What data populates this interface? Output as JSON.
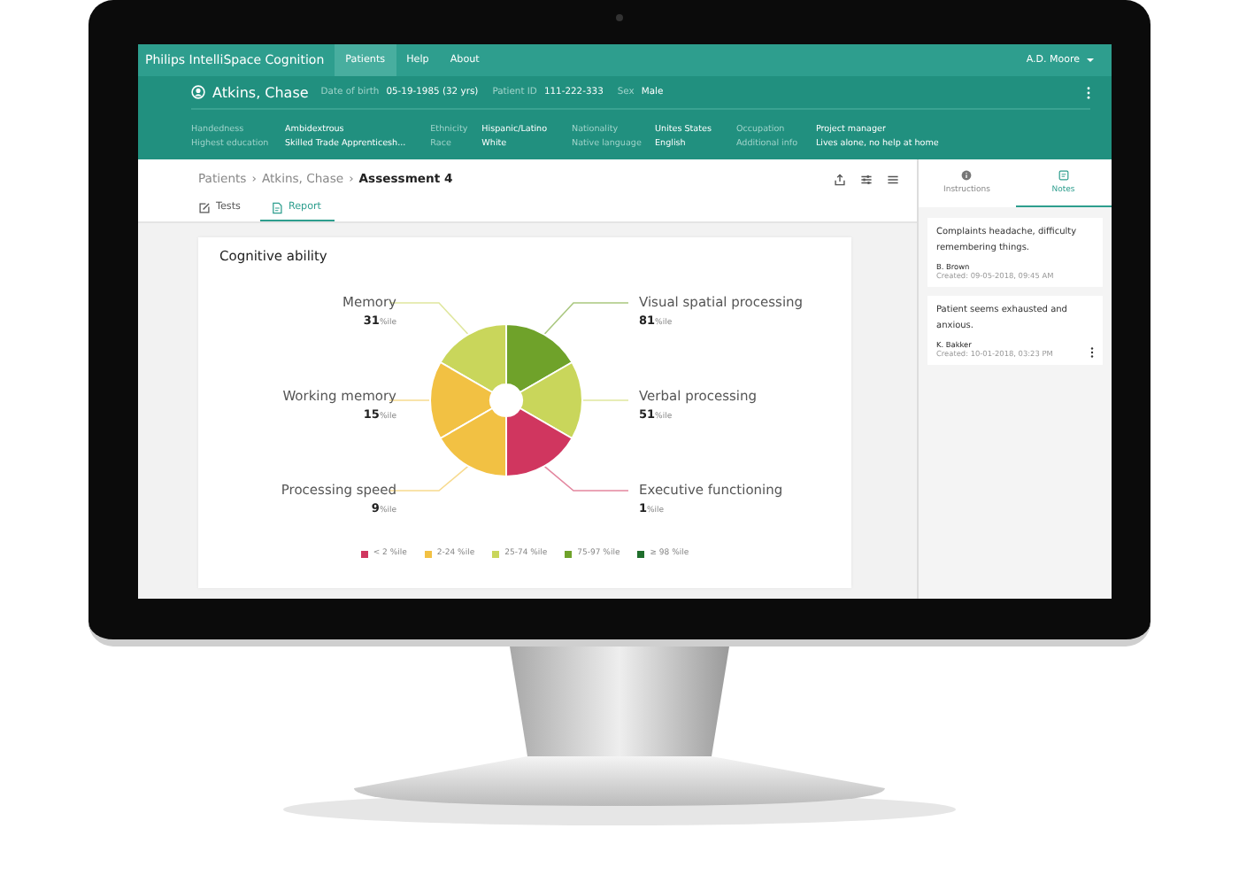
{
  "app": {
    "brand": "Philips IntelliSpace Cognition",
    "nav": [
      {
        "label": "Patients",
        "selected": true
      },
      {
        "label": "Help",
        "selected": false
      },
      {
        "label": "About",
        "selected": false
      }
    ],
    "user": "A.D. Moore"
  },
  "patient": {
    "name": "Atkins, Chase",
    "summary": [
      {
        "label": "Date of birth",
        "value": "05-19-1985 (32 yrs)"
      },
      {
        "label": "Patient ID",
        "value": "111-222-333"
      },
      {
        "label": "Sex",
        "value": "Male"
      }
    ],
    "details": [
      {
        "label": "Handedness",
        "value": "Ambidextrous"
      },
      {
        "label": "Highest education",
        "value": "Skilled Trade Apprenticesh..."
      },
      {
        "label": "Ethnicity",
        "value": "Hispanic/Latino"
      },
      {
        "label": "Race",
        "value": "White"
      },
      {
        "label": "Nationality",
        "value": "Unites States"
      },
      {
        "label": "Native language",
        "value": "English"
      },
      {
        "label": "Occupation",
        "value": "Project manager"
      },
      {
        "label": "Additional info",
        "value": "Lives alone, no help at home"
      }
    ]
  },
  "breadcrumb": {
    "items": [
      "Patients",
      "Atkins, Chase",
      "Assessment 4"
    ],
    "separator": "›"
  },
  "tabs": [
    {
      "label": "Tests",
      "kind": "tests",
      "selected": false
    },
    {
      "label": "Report",
      "kind": "report",
      "selected": true
    }
  ],
  "card": {
    "title": "Cognitive ability",
    "domains": [
      {
        "name": "Memory",
        "value": "31",
        "unit": "%ile",
        "color": "#c9d65b"
      },
      {
        "name": "Visual spatial processing",
        "value": "81",
        "unit": "%ile",
        "color": "#6fa22a"
      },
      {
        "name": "Working memory",
        "value": "15",
        "unit": "%ile",
        "color": "#f2c143"
      },
      {
        "name": "Verbal processing",
        "value": "51",
        "unit": "%ile",
        "color": "#c9d65b"
      },
      {
        "name": "Processing speed",
        "value": "9",
        "unit": "%ile",
        "color": "#f2c143"
      },
      {
        "name": "Executive functioning",
        "value": "1",
        "unit": "%ile",
        "color": "#d0365f"
      }
    ],
    "legend": [
      {
        "label": "< 2 %ile",
        "color": "#d0365f"
      },
      {
        "label": "2-24 %ile",
        "color": "#f2c143"
      },
      {
        "label": "25-74 %ile",
        "color": "#c9d65b"
      },
      {
        "label": "75-97 %ile",
        "color": "#6fa22a"
      },
      {
        "label": "≥ 98 %ile",
        "color": "#1f6e2c"
      }
    ]
  },
  "side_tabs": [
    {
      "label": "Instructions",
      "kind": "info",
      "selected": false
    },
    {
      "label": "Notes",
      "kind": "notes",
      "selected": true
    }
  ],
  "notes": [
    {
      "text": "Complaints headache, difficulty remembering things.",
      "author": "B. Brown",
      "created": "Created: 09-05-2018, 09:45 AM",
      "menu": false
    },
    {
      "text": "Patient seems exhausted and anxious.",
      "author": "K. Bakker",
      "created": "Created: 10-01-2018, 03:23 PM",
      "menu": true
    }
  ]
}
